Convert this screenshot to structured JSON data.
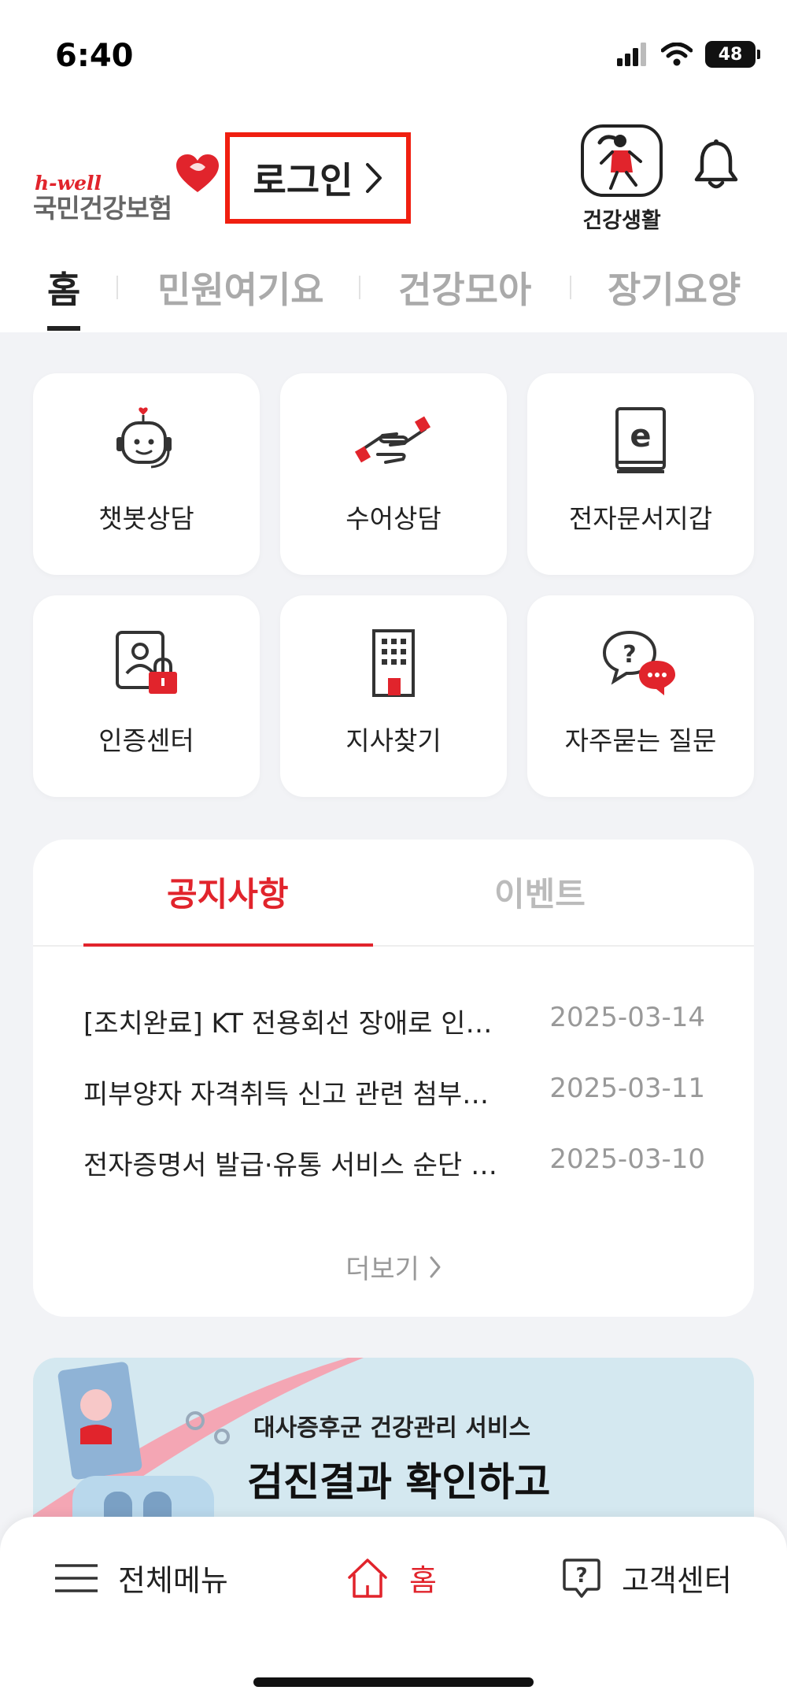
{
  "status_bar": {
    "time": "6:40",
    "battery": "48",
    "icons": [
      "signal-icon",
      "wifi-icon",
      "battery-icon"
    ]
  },
  "header": {
    "logo_top": "h-well",
    "logo_name": "국민건강보험",
    "login_label": "로그인",
    "health_life_label": "건강생활",
    "notification_icon": "bell-icon"
  },
  "tabs": [
    {
      "label": "홈",
      "active": true
    },
    {
      "label": "민원여기요",
      "active": false
    },
    {
      "label": "건강모아",
      "active": false
    },
    {
      "label": "장기요양",
      "active": false
    }
  ],
  "quick_menu": [
    {
      "label": "챗봇상담",
      "icon": "chatbot-icon"
    },
    {
      "label": "수어상담",
      "icon": "sign-language-icon"
    },
    {
      "label": "전자문서지갑",
      "icon": "e-document-icon"
    },
    {
      "label": "인증센터",
      "icon": "certificate-lock-icon"
    },
    {
      "label": "지사찾기",
      "icon": "building-icon"
    },
    {
      "label": "자주묻는 질문",
      "icon": "faq-icon"
    }
  ],
  "notice": {
    "tabs": [
      {
        "label": "공지사항",
        "active": true
      },
      {
        "label": "이벤트",
        "active": false
      }
    ],
    "items": [
      {
        "title": "[조치완료] KT 전용회선 장애로 인…",
        "date": "2025-03-14"
      },
      {
        "title": "피부양자 자격취득 신고 관련 첨부…",
        "date": "2025-03-11"
      },
      {
        "title": "전자증명서 발급·유통 서비스 순단 …",
        "date": "2025-03-10"
      }
    ],
    "more_label": "더보기"
  },
  "banner": {
    "subtitle": "대사증후군 건강관리 서비스",
    "title": "검진결과 확인하고"
  },
  "bottom_nav": {
    "menu_label": "전체메뉴",
    "home_label": "홈",
    "support_label": "고객센터"
  },
  "colors": {
    "accent": "#e1242c",
    "login_highlight": "#f01f10",
    "background": "#f2f3f6"
  }
}
